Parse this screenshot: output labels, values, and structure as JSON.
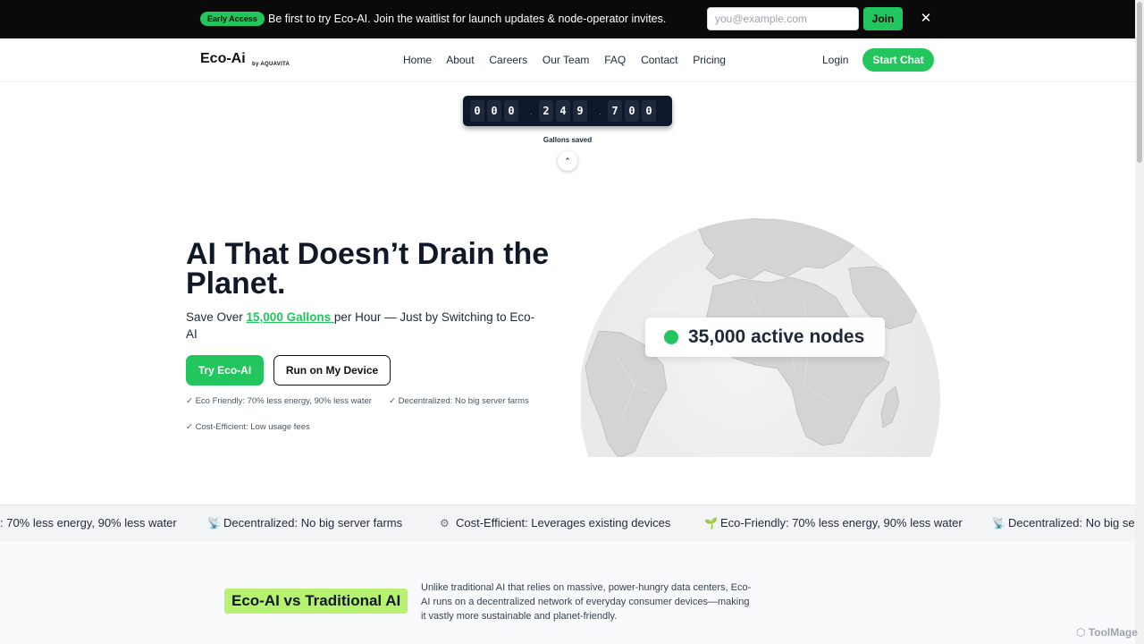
{
  "banner": {
    "badge": "Early Access",
    "message": "Be first to try Eco-AI. Join the waitlist for launch updates & node-operator invites.",
    "email_placeholder": "you@example.com",
    "join_label": "Join",
    "close_label": "✕"
  },
  "nav": {
    "logo": "Eco-Ai",
    "logo_sub": "by AQUAVITA",
    "links": [
      "Home",
      "About",
      "Careers",
      "Our Team",
      "FAQ",
      "Contact",
      "Pricing"
    ],
    "login": "Login",
    "start_chat": "Start Chat"
  },
  "counter": {
    "digits": [
      "0",
      "0",
      "0",
      "2",
      "4",
      "9",
      "7",
      "0",
      "0"
    ],
    "label": "Gallons saved",
    "collapse_icon": "⌃"
  },
  "hero": {
    "title": "AI That Doesn’t Drain the Planet.",
    "subtitle_before": "Save Over ",
    "subtitle_highlight": "15,000 Gallons ",
    "subtitle_after": " per Hour — Just by Switching to Eco-AI",
    "try_button": "Try Eco-AI",
    "run_button": "Run on My Device",
    "features": [
      "✓ Eco Friendly: 70% less energy, 90% less water",
      "✓ Decentralized: No big server farms",
      "✓ Cost-Efficient: Low usage fees"
    ]
  },
  "globe": {
    "nodes_text": "35,000 active nodes"
  },
  "ticker": {
    "items": [
      {
        "icon": "",
        "text": ": 70% less energy, 90% less water"
      },
      {
        "icon": "📡",
        "text": "Decentralized: No big server farms"
      },
      {
        "icon": "⚙",
        "text": "Cost-Efficient: Leverages existing devices"
      },
      {
        "icon": "🌱",
        "text": "Eco-Friendly: 70% less energy, 90% less water"
      },
      {
        "icon": "📡",
        "text": "Decentralized: No big server farms"
      }
    ]
  },
  "compare": {
    "title": "Eco-AI vs Traditional AI",
    "text": "Unlike traditional AI that relies on massive, power-hungry data centers, Eco-AI runs on a decentralized network of everyday consumer devices—making it vastly more sustainable and planet-friendly."
  },
  "watermark": "ToolMage",
  "colors": {
    "accent": "#22c55e",
    "banner_bg": "#0a0a0a",
    "highlight": "#b6f26f"
  }
}
